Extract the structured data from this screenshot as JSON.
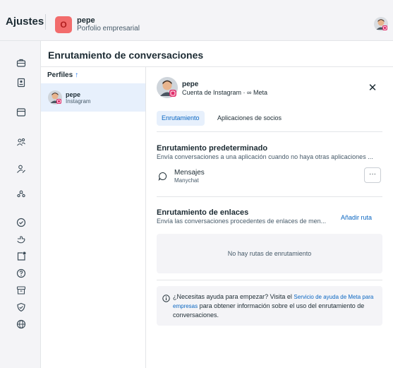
{
  "header": {
    "app_title": "Ajustes",
    "business": {
      "avatar_letter": "O",
      "name": "pepe",
      "subtitle": "Porfolio empresarial"
    },
    "user_avatar": "user-avatar"
  },
  "sidebar": {
    "icons": [
      "briefcase-icon",
      "badge-icon",
      "inbox-icon",
      "people-icon",
      "person-edit-icon",
      "people-group-icon",
      "check-circle-icon",
      "hand-icon",
      "notification-square-icon",
      "help-icon",
      "archive-icon",
      "shield-icon",
      "globe-icon"
    ]
  },
  "page": {
    "title": "Enrutamiento de conversaciones"
  },
  "profiles": {
    "header": "Perfiles",
    "sort_arrow": "↑",
    "items": [
      {
        "name": "pepe",
        "platform": "Instagram"
      }
    ]
  },
  "detail": {
    "name": "pepe",
    "subtitle": "Cuenta de Instagram · ∞ Meta",
    "close_symbol": "✕",
    "tabs": [
      {
        "label": "Enrutamiento",
        "active": true
      },
      {
        "label": "Aplicaciones de socios",
        "active": false
      }
    ],
    "default_routing": {
      "title": "Enrutamiento predeterminado",
      "description": "Envía conversaciones a una aplicación cuando no haya otras aplicaciones ...",
      "app_name": "Mensajes",
      "app_sub": "Manychat",
      "more_symbol": "···"
    },
    "link_routing": {
      "title": "Enrutamiento de enlaces",
      "description": "Envía las conversaciones procedentes de enlaces de men...",
      "add_route": "Añadir ruta",
      "empty": "No hay rutas de enrutamiento"
    },
    "help": {
      "prefix": "¿Necesitas ayuda para empezar? Visita el ",
      "link": "Servicio de ayuda de Meta para empresas",
      "suffix": " para obtener información sobre el uso del enrutamiento de conversaciones."
    }
  },
  "colors": {
    "accent": "#0a66c2",
    "selected_bg": "#e7f0fc",
    "business_avatar": "#f26c6c"
  }
}
